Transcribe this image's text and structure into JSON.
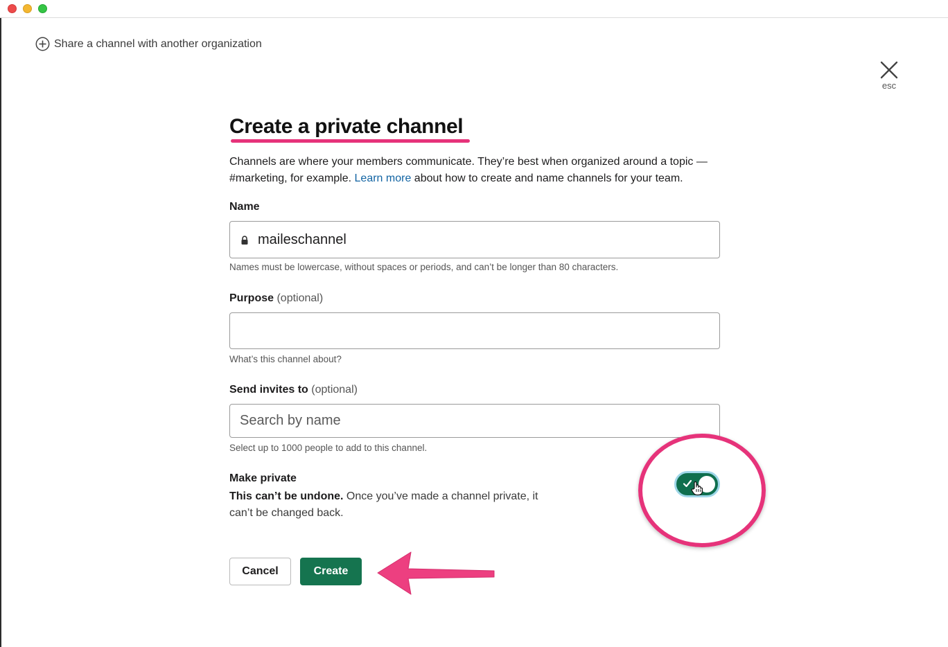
{
  "window": {
    "traffic_lights": [
      "close",
      "minimize",
      "zoom"
    ]
  },
  "share": {
    "label": "Share a channel with another organization"
  },
  "close": {
    "hint": "esc"
  },
  "dialog": {
    "title": "Create a private channel",
    "description_before_link": "Channels are where your members communicate. They’re best when organized around a topic — #marketing, for example. ",
    "learn_more_link": "Learn more",
    "description_after_link": " about how to create and name channels for your team."
  },
  "name_field": {
    "label": "Name",
    "value": "maileschannel",
    "hint": "Names must be lowercase, without spaces or periods, and can’t be longer than 80 characters."
  },
  "purpose_field": {
    "label": "Purpose",
    "optional": "(optional)",
    "value": "",
    "hint": "What’s this channel about?"
  },
  "invite_field": {
    "label": "Send invites to",
    "optional": "(optional)",
    "placeholder": "Search by name",
    "hint": "Select up to 1000 people to add to this channel."
  },
  "make_private": {
    "title": "Make private",
    "warning_bold": "This can’t be undone.",
    "warning_rest": " Once you’ve made a channel private, it can’t be changed back.",
    "enabled": true
  },
  "buttons": {
    "cancel": "Cancel",
    "create": "Create"
  },
  "colors": {
    "accent_annotation": "#e6337a",
    "primary_button": "#15744f",
    "toggle_on": "#0f6f4e",
    "link": "#1264a3"
  }
}
